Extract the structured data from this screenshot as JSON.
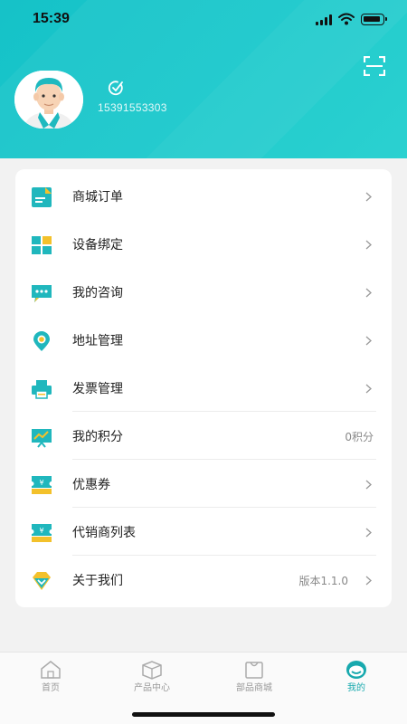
{
  "status_bar": {
    "time": "15:39"
  },
  "profile": {
    "phone": "15391553303"
  },
  "menu": [
    {
      "label": "商城订单",
      "icon": "document-icon",
      "value": ""
    },
    {
      "label": "设备绑定",
      "icon": "grid-icon",
      "value": ""
    },
    {
      "label": "我的咨询",
      "icon": "chat-icon",
      "value": ""
    },
    {
      "label": "地址管理",
      "icon": "location-pin-icon",
      "value": ""
    },
    {
      "label": "发票管理",
      "icon": "printer-icon",
      "value": ""
    },
    {
      "label": "我的积分",
      "icon": "points-chart-icon",
      "value": "0积分"
    },
    {
      "label": "优惠券",
      "icon": "coupon-icon",
      "value": ""
    },
    {
      "label": "代销商列表",
      "icon": "coupon-icon",
      "value": ""
    },
    {
      "label": "关于我们",
      "icon": "about-diamond-icon",
      "value": "版本1.1.0"
    }
  ],
  "tabbar": {
    "tabs": [
      {
        "label": "首页",
        "icon": "home-icon",
        "active": false
      },
      {
        "label": "产品中心",
        "icon": "box-icon",
        "active": false
      },
      {
        "label": "部品商城",
        "icon": "shopping-bag-icon",
        "active": false
      },
      {
        "label": "我的",
        "icon": "profile-icon",
        "active": true
      }
    ]
  },
  "colors": {
    "accent": "#19c4c9",
    "icon_teal": "#20b7bd",
    "icon_yellow": "#f3c12b",
    "active_tab": "#18a9ae"
  }
}
